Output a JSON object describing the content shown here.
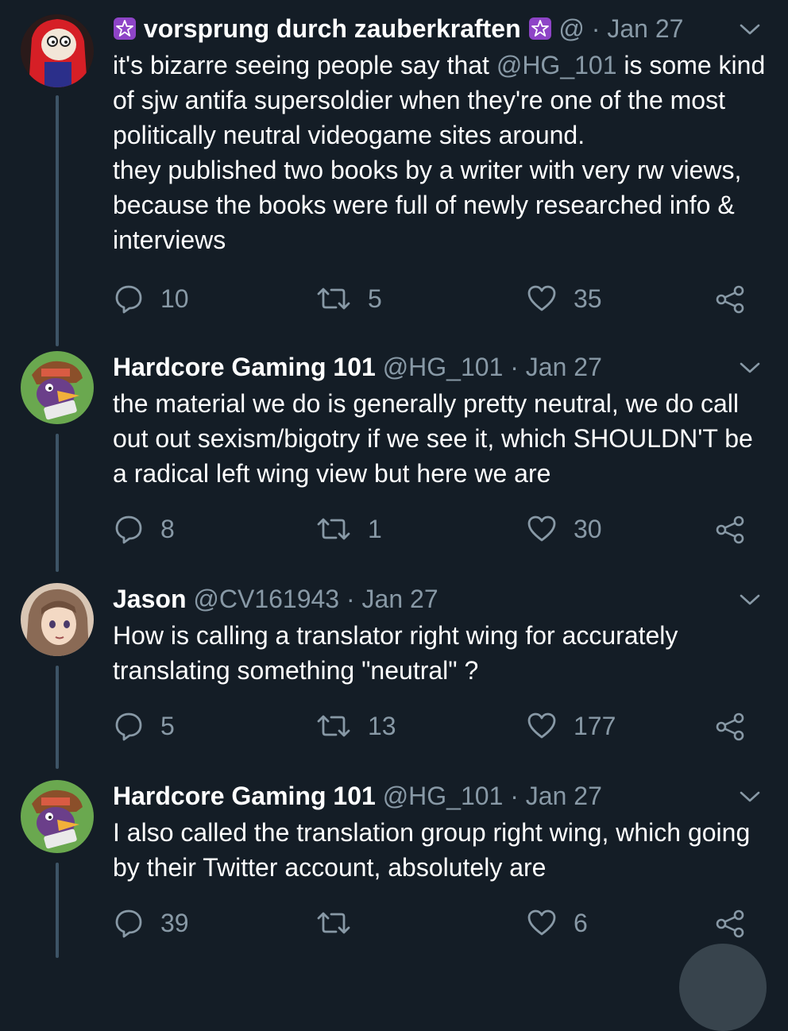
{
  "colors": {
    "background": "#141d26",
    "secondary_text": "#8899a6",
    "thread_line": "#3d5466"
  },
  "tweets": [
    {
      "name": "vorsprung durch zauberkraften",
      "handle": "@",
      "dot": "·",
      "date": "Jan 27",
      "badge_icon": "purple-star-badge",
      "text_pre": "it's bizarre seeing people say that ",
      "mention": "@HG_101",
      "text_post": " is some kind of sjw antifa supersoldier when they're one of the most politically neutral videogame sites around.\nthey published two books by a writer with very rw views, because the books were full of newly researched info & interviews",
      "replies": "10",
      "retweets": "5",
      "likes": "35"
    },
    {
      "name": "Hardcore Gaming 101",
      "handle": "@HG_101",
      "dot": "·",
      "date": "Jan 27",
      "text": "the material we do is generally pretty neutral, we do call out out sexism/bigotry if we see it, which SHOULDN'T be a radical left wing view but here we are",
      "replies": "8",
      "retweets": "1",
      "likes": "30"
    },
    {
      "name": "Jason",
      "handle": "@CV161943",
      "dot": "·",
      "date": "Jan 27",
      "text": "How is calling a translator right wing for accurately translating something \"neutral\" ?",
      "replies": "5",
      "retweets": "13",
      "likes": "177"
    },
    {
      "name": "Hardcore Gaming 101",
      "handle": "@HG_101",
      "dot": "·",
      "date": "Jan 27",
      "text": "I also called the translation group right wing, which going by their Twitter account, absolutely are",
      "replies": "39",
      "retweets": "",
      "likes": "6"
    }
  ]
}
